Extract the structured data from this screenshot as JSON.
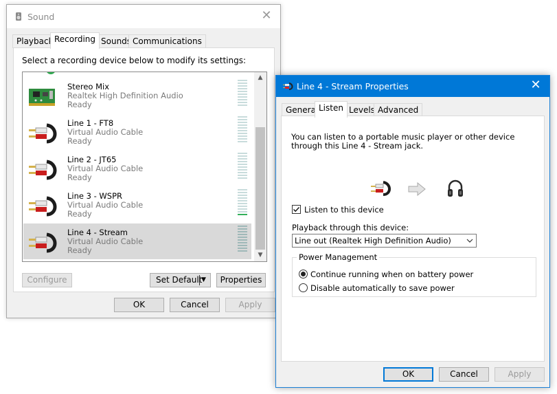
{
  "sound_window": {
    "title": "Sound",
    "tabs": [
      "Playback",
      "Recording",
      "Sounds",
      "Communications"
    ],
    "active_tab": "Recording",
    "instruction": "Select a recording device below to modify its settings:",
    "devices": [
      {
        "name": "Stereo Mix",
        "driver": "Realtek High Definition Audio",
        "status": "Ready",
        "icon": "sound-card-icon",
        "level": 0.0,
        "selected": false
      },
      {
        "name": "Line 1 - FT8",
        "driver": "Virtual Audio Cable",
        "status": "Ready",
        "icon": "audio-cable-icon",
        "level": 0.0,
        "selected": false
      },
      {
        "name": "Line 2 - JT65",
        "driver": "Virtual Audio Cable",
        "status": "Ready",
        "icon": "audio-cable-icon",
        "level": 0.0,
        "selected": false
      },
      {
        "name": "Line 3 - WSPR",
        "driver": "Virtual Audio Cable",
        "status": "Ready",
        "icon": "audio-cable-icon",
        "level": 0.1,
        "selected": false
      },
      {
        "name": "Line 4 - Stream",
        "driver": "Virtual Audio Cable",
        "status": "Ready",
        "icon": "audio-cable-icon",
        "level": 0.0,
        "selected": true
      }
    ],
    "buttons": {
      "configure": "Configure",
      "set_default": "Set Default",
      "properties": "Properties",
      "ok": "OK",
      "cancel": "Cancel",
      "apply": "Apply"
    }
  },
  "properties_window": {
    "title": "Line 4 - Stream Properties",
    "tabs": [
      "General",
      "Listen",
      "Levels",
      "Advanced"
    ],
    "active_tab": "Listen",
    "description": "You can listen to a portable music player or other device through this Line 4 - Stream jack.",
    "listen_checkbox": {
      "label": "Listen to this device",
      "checked": true
    },
    "playback_label": "Playback through this device:",
    "playback_device": "Line out (Realtek High Definition Audio)",
    "power_management": {
      "legend": "Power Management",
      "options": [
        {
          "label": "Continue running when on battery power",
          "selected": true
        },
        {
          "label": "Disable automatically to save power",
          "selected": false
        }
      ]
    },
    "buttons": {
      "ok": "OK",
      "cancel": "Cancel",
      "apply": "Apply"
    }
  },
  "colors": {
    "accent": "#0078d7",
    "selected_row": "#d9d9d9",
    "meter_active": "#33b05a"
  }
}
